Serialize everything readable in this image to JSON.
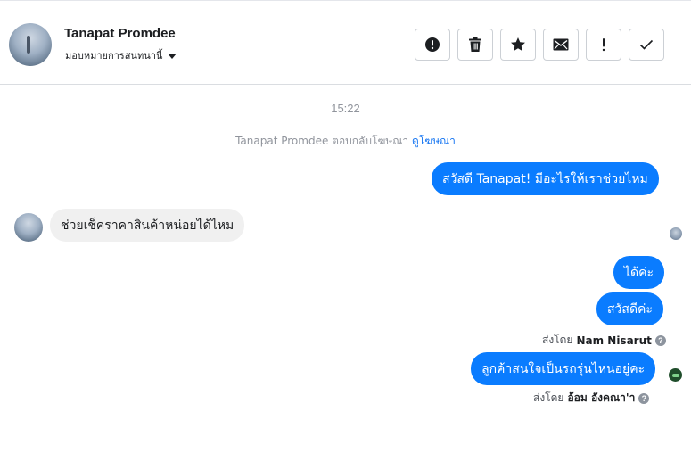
{
  "header": {
    "contact_name": "Tanapat Promdee",
    "assign_label": "มอบหมายการสนทนานี้"
  },
  "toolbar": {
    "buttons": [
      {
        "icon": "alert-circle-icon",
        "name": "mark-spam-button"
      },
      {
        "icon": "trash-icon",
        "name": "delete-button"
      },
      {
        "icon": "star-icon",
        "name": "star-button"
      },
      {
        "icon": "envelope-icon",
        "name": "mark-unread-button"
      },
      {
        "icon": "exclamation-icon",
        "name": "follow-up-button"
      },
      {
        "icon": "check-icon",
        "name": "mark-done-button"
      }
    ]
  },
  "conversation": {
    "timestamp": "15:22",
    "reply_note": {
      "text": "Tanapat Promdee ตอบกลับโฆษณา",
      "link": "ดูโฆษณา"
    },
    "messages": [
      {
        "direction": "out",
        "text": "สวัสดี Tanapat! มีอะไรให้เราช่วยไหม"
      },
      {
        "direction": "in",
        "text": "ช่วยเช็คราคาสินค้าหน่อยได้ไหม"
      },
      {
        "direction": "out",
        "text": "ได้ค่ะ"
      },
      {
        "direction": "out",
        "text": "สวัสดีค่ะ"
      },
      {
        "direction": "out",
        "text": "ลูกค้าสนใจเป็นรถรุ่นไหนอยู่คะ"
      }
    ],
    "sent_by_1": {
      "prefix": "ส่งโดย",
      "name": "Nam Nisarut"
    },
    "sent_by_2": {
      "prefix": "ส่งโดย",
      "name": "อ้อม อังคณา'า"
    }
  },
  "colors": {
    "outgoing_bubble": "#0a7cff",
    "incoming_bubble": "#f0f0f0",
    "link": "#1877f2",
    "muted_text": "#90949c"
  }
}
